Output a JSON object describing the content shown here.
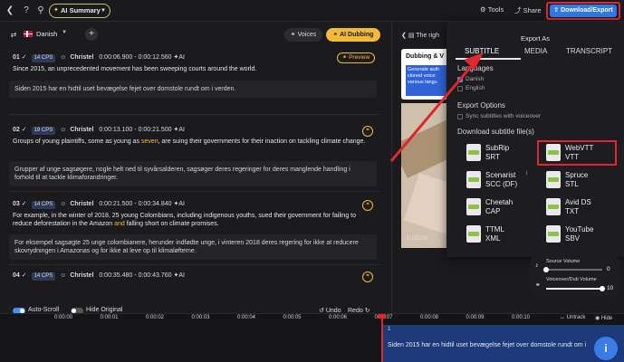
{
  "topbar": {
    "back_icon": "back-arrow-icon",
    "help_label": "?",
    "ai_summary_label": "AI Summary",
    "tools_label": "Tools",
    "share_label": "Share",
    "download_label": "Download/Export"
  },
  "language_bar": {
    "language": "Danish",
    "voices_label": "Voices",
    "ai_dubbing_label": "AI Dubbing"
  },
  "segments": [
    {
      "num": "01",
      "cps": "14 CPS",
      "speaker": "Christel",
      "start": "0:00:06.900",
      "end": "0:00:12.560",
      "ai": "AI",
      "action_label": "Preview",
      "text": "Since 2015, an unprecedented movement has been sweeping courts around the world.",
      "translation": "Siden 2015 har en hidtil uset bevægelse fejet over domstole rundt om i verden."
    },
    {
      "num": "02",
      "cps": "19 CPS",
      "speaker": "Christel",
      "start": "0:00:13.100",
      "end": "0:00:21.500",
      "ai": "AI",
      "text_a": "Groups of young plaintiffs, some as young as ",
      "text_hl": "seven",
      "text_b": ", are suing their governments for their inaction on tackling climate change.",
      "translation": "Grupper af unge sagsøgere, nogle helt ned til syvårsalderen, sagsøger deres regeringer for deres manglende handling i forhold til at tackle klimaforandringer."
    },
    {
      "num": "03",
      "cps": "14 CPS",
      "speaker": "Christel",
      "start": "0:00:21.500",
      "end": "0:00:34.840",
      "ai": "AI",
      "text_a": "For example, in the winter of 2018, 25 young Colombians, including indigenous youths, sued their government for failing to reduce deforestation in the Amazon ",
      "text_hl": "and",
      "text_b": " falling short on climate promises.",
      "translation": "For eksempel sagsøgte 25 unge colombianere, herunder indfødte unge, i vinteren 2018 deres regering for ikke at reducere skovrydningen i Amazonas og for ikke at leve op til klimaløfterne."
    },
    {
      "num": "04",
      "cps": "14 CPS",
      "speaker": "Christel",
      "start": "0:00:35.480",
      "end": "0:00:43.760",
      "ai": "AI"
    }
  ],
  "bottom_controls": {
    "auto_scroll_label": "Auto-Scroll",
    "hide_original_label": "Hide Original",
    "undo_label": "Undo",
    "redo_label": "Redo"
  },
  "right_panel": {
    "head_text": "The righ",
    "card_title": "Dubbing & V",
    "card_body": "Generate auth cloned voice various langu",
    "timecode": "0:00:06"
  },
  "export_menu": {
    "title": "Export As",
    "tabs": [
      "SUBTITLE",
      "MEDIA",
      "TRANSCRIPT"
    ],
    "languages_label": "Languages",
    "languages": [
      "Danish",
      "English"
    ],
    "export_options_label": "Export Options",
    "sync_label": "Sync subtitles with voiceover",
    "download_files_label": "Download subtitle file(s)",
    "formats": [
      {
        "name": "SubRip",
        "ext": "SRT"
      },
      {
        "name": "WebVTT",
        "ext": "VTT"
      },
      {
        "name": "Scenarist",
        "ext": "SCC (DF)",
        "info": "i"
      },
      {
        "name": "Spruce",
        "ext": "STL"
      },
      {
        "name": "Cheetah",
        "ext": "CAP"
      },
      {
        "name": "Avid DS",
        "ext": "TXT"
      },
      {
        "name": "TTML",
        "ext": "XML"
      },
      {
        "name": "YouTube",
        "ext": "SBV"
      }
    ]
  },
  "volume": {
    "source_label": "Source Volume",
    "source_value": "0",
    "source_level": 0,
    "voiceover_label": "Voiceover/Dub Volume",
    "voiceover_value": "10",
    "voiceover_level": 1
  },
  "timeline": {
    "ticks": [
      "0:00:00",
      "0:00:01",
      "0:00:02",
      "0:00:03",
      "0:00:04",
      "0:00:05",
      "0:00:06",
      "0:00:07",
      "0:00:08",
      "0:00:09",
      "0:00:10"
    ],
    "untrack_label": "Untrack",
    "hide_label": "Hide",
    "track_number": "1",
    "track_text": "Siden 2015 har en hidtil uset bevægelse fejet over domstole rundt om i"
  },
  "help_label": "i"
}
